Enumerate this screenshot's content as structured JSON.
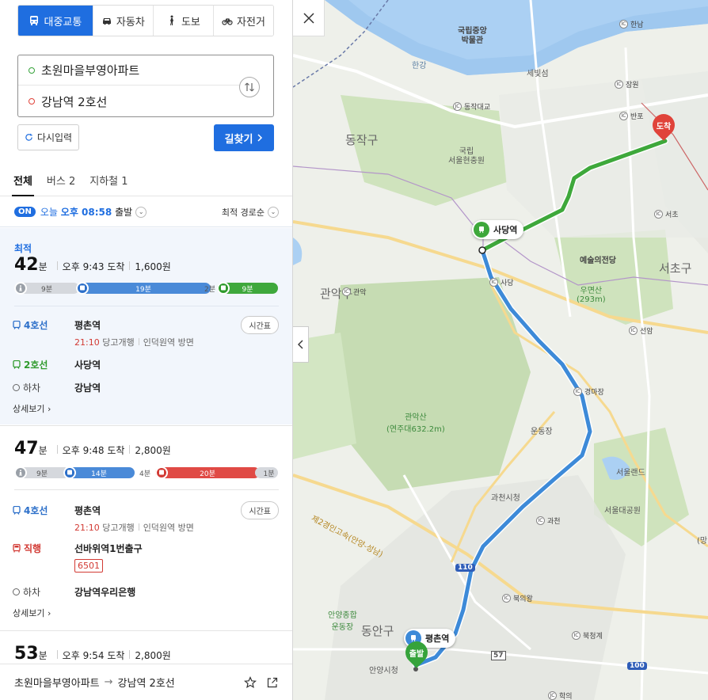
{
  "modes": [
    {
      "label": "대중교통",
      "icon": "bus-icon",
      "active": true
    },
    {
      "label": "자동차",
      "icon": "car-icon",
      "active": false
    },
    {
      "label": "도보",
      "icon": "walk-icon",
      "active": false
    },
    {
      "label": "자전거",
      "icon": "bicycle-icon",
      "active": false
    }
  ],
  "route": {
    "origin": "초원마을부영아파트",
    "destination": "강남역 2호선"
  },
  "buttons": {
    "reset": "다시입력",
    "search": "길찾기"
  },
  "result_tabs": [
    "전체",
    "버스 2",
    "지하철 1"
  ],
  "depart": {
    "on": "ON",
    "prefix": "오늘",
    "time": "오후 08:58",
    "suffix": "출발",
    "sort": "최적 경로순"
  },
  "routes": [
    {
      "best_label": "최적",
      "minutes": "42",
      "unit": "분",
      "arrive": "오후 9:43 도착",
      "fare": "1,600원",
      "timeline": {
        "walk1": "9분",
        "seg1": "19분",
        "gap": "2분",
        "seg2": "9분"
      },
      "steps": [
        {
          "line": "4호선",
          "station": "평촌역",
          "time": "21:10",
          "sub": "당고개행",
          "dir": "인덕원역 방면",
          "timetable": "시간표"
        },
        {
          "line": "2호선",
          "station": "사당역"
        },
        {
          "line": "하차",
          "station": "강남역"
        }
      ],
      "detail": "상세보기"
    },
    {
      "minutes": "47",
      "unit": "분",
      "arrive": "오후 9:48 도착",
      "fare": "2,800원",
      "timeline": {
        "walk1": "9분",
        "seg1": "14분",
        "gap": "4분",
        "seg2": "20분",
        "end": "1분"
      },
      "steps": [
        {
          "line": "4호선",
          "station": "평촌역",
          "time": "21:10",
          "sub": "당고개행",
          "dir": "인덕원역 방면",
          "timetable": "시간표"
        },
        {
          "line": "직행",
          "station": "선바위역1번출구",
          "bus_no": "6501"
        },
        {
          "line": "하차",
          "station": "강남역우리은행"
        }
      ],
      "detail": "상세보기"
    },
    {
      "minutes": "53",
      "unit": "분",
      "arrive": "오후 9:54 도착",
      "fare": "2,800원"
    }
  ],
  "footer": {
    "from": "초원마을부영아파트",
    "to": "강남역 2호선"
  },
  "map": {
    "labels": {
      "museum": "국립중앙\n박물관",
      "hangang": "한강",
      "sebitseom": "세빛섬",
      "hannam": "한남",
      "jamwon": "잠원",
      "banpo": "반포",
      "dongjakdaegyo": "동작대교",
      "dongjak_gu": "동작구",
      "cemetery": "국립\n서울현충원",
      "seocho_ic": "서초",
      "seocho_gu": "서초구",
      "arts_center": "예술의전당",
      "sadang_ic": "사당",
      "umyeonsan": "우면산\n(293m)",
      "gwanak_gu": "관악구",
      "gwanak_ic": "관악",
      "seonam": "선암",
      "gyeongmajang": "경마장",
      "gwanaksan": "관악산\n(연주대632.2m)",
      "undongjang": "운동장",
      "seoulland": "서울랜드",
      "grandpark": "서울대공원",
      "gwacheon_hall": "과천시청",
      "gwacheon_ic": "과천",
      "highway": "제2경인고속(안양-성남)",
      "route110": "110",
      "bukuiwang": "북의왕",
      "anyang_sports": "안양종합\n운동장",
      "dongan_gu": "동안구",
      "anyang_hall": "안양시청",
      "bukcheonggye": "북청계",
      "route57": "57",
      "route100": "100",
      "hakui": "학의",
      "edge": "(망"
    },
    "pins": {
      "dest": "도착",
      "origin": "출발",
      "sadang_station": "사당역",
      "pyeongchon_station": "평촌역"
    },
    "colors": {
      "subway4": "#3d8ad8",
      "subway2": "#3ea83b",
      "dest": "#e0433a",
      "origin": "#36a33b",
      "accent": "#1f6ee0"
    }
  }
}
